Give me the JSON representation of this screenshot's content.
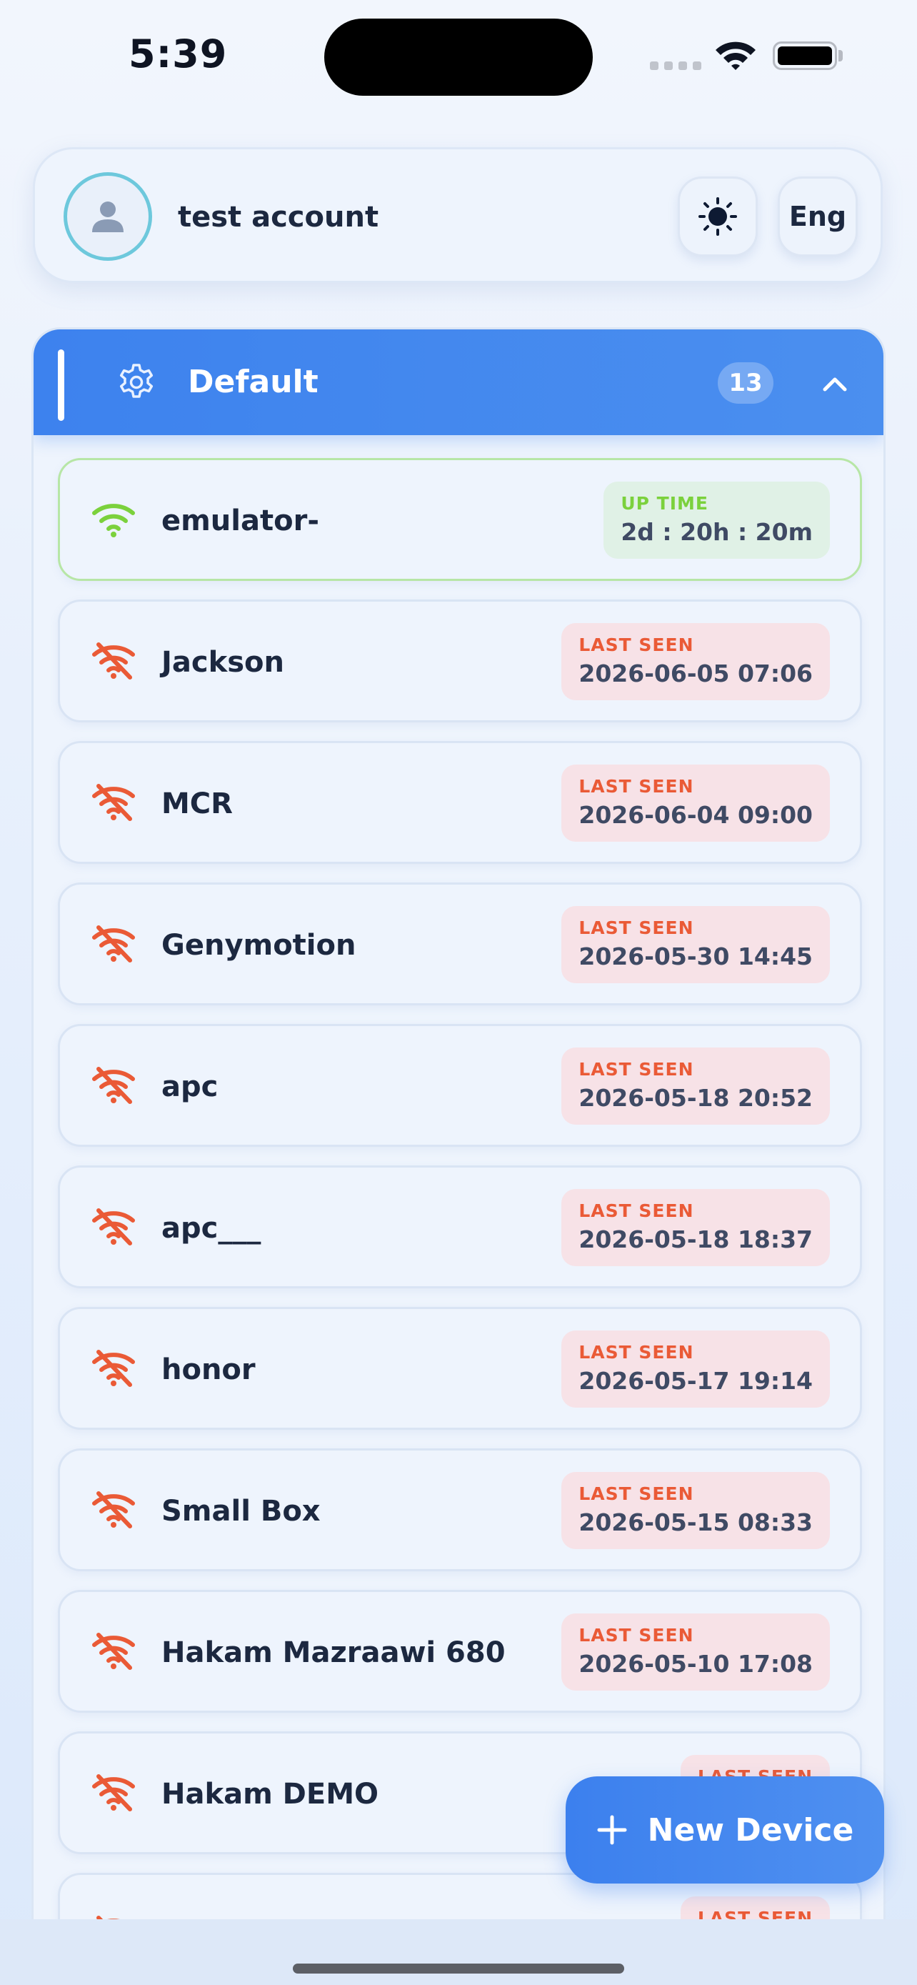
{
  "status_bar": {
    "time": "5:39"
  },
  "account": {
    "name": "test account",
    "language_label": "Eng",
    "theme_icon": "sun-icon"
  },
  "group": {
    "title": "Default",
    "count": "13"
  },
  "devices": [
    {
      "name": "emulator-",
      "status": "online",
      "badge_label": "UP TIME",
      "badge_value": "2d : 20h : 20m"
    },
    {
      "name": "Jackson",
      "status": "offline",
      "badge_label": "LAST SEEN",
      "badge_value": "2026-06-05 07:06"
    },
    {
      "name": "MCR",
      "status": "offline",
      "badge_label": "LAST SEEN",
      "badge_value": "2026-06-04 09:00"
    },
    {
      "name": "Genymotion",
      "status": "offline",
      "badge_label": "LAST SEEN",
      "badge_value": "2026-05-30 14:45"
    },
    {
      "name": "apc",
      "status": "offline",
      "badge_label": "LAST SEEN",
      "badge_value": "2026-05-18 20:52"
    },
    {
      "name": "apc___",
      "status": "offline",
      "badge_label": "LAST SEEN",
      "badge_value": "2026-05-18 18:37"
    },
    {
      "name": "honor",
      "status": "offline",
      "badge_label": "LAST SEEN",
      "badge_value": "2026-05-17 19:14"
    },
    {
      "name": "Small Box",
      "status": "offline",
      "badge_label": "LAST SEEN",
      "badge_value": "2026-05-15 08:33"
    },
    {
      "name": "Hakam Mazraawi 680",
      "status": "offline",
      "badge_label": "LAST SEEN",
      "badge_value": "2026-05-10 17:08"
    },
    {
      "name": "Hakam DEMO",
      "status": "offline",
      "badge_label": "LAST SEEN",
      "badge_value": ""
    },
    {
      "name": "",
      "status": "offline",
      "badge_label": "LAST SEEN",
      "badge_value": ""
    }
  ],
  "fab": {
    "label": "New Device",
    "icon": "plus-icon"
  },
  "colors": {
    "accent": "#3d82ee",
    "online": "#7bd13c",
    "offline": "#ea5a36"
  }
}
